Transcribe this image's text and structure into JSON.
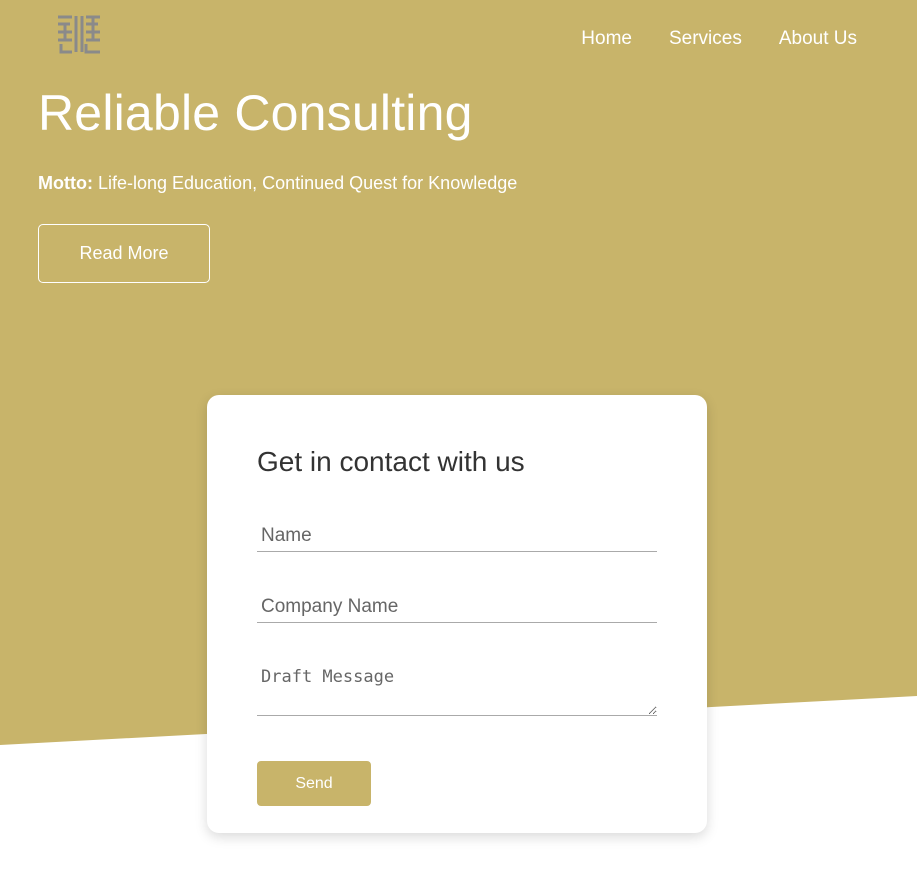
{
  "colors": {
    "brand_gold": "#c8b46a",
    "white": "#ffffff",
    "logo_gray": "#8a8a8a"
  },
  "header": {
    "logo_icon": "chinese-character-logo-icon",
    "nav": {
      "home": "Home",
      "services": "Services",
      "about": "About Us"
    }
  },
  "hero": {
    "title": "Reliable Consulting",
    "motto_label": "Motto:",
    "motto_text": " Life-long Education, Continued Quest for Knowledge",
    "read_more": "Read More"
  },
  "contact": {
    "title": "Get in contact with us",
    "name_placeholder": "Name",
    "company_placeholder": "Company Name",
    "message_placeholder": "Draft Message",
    "send": "Send"
  }
}
